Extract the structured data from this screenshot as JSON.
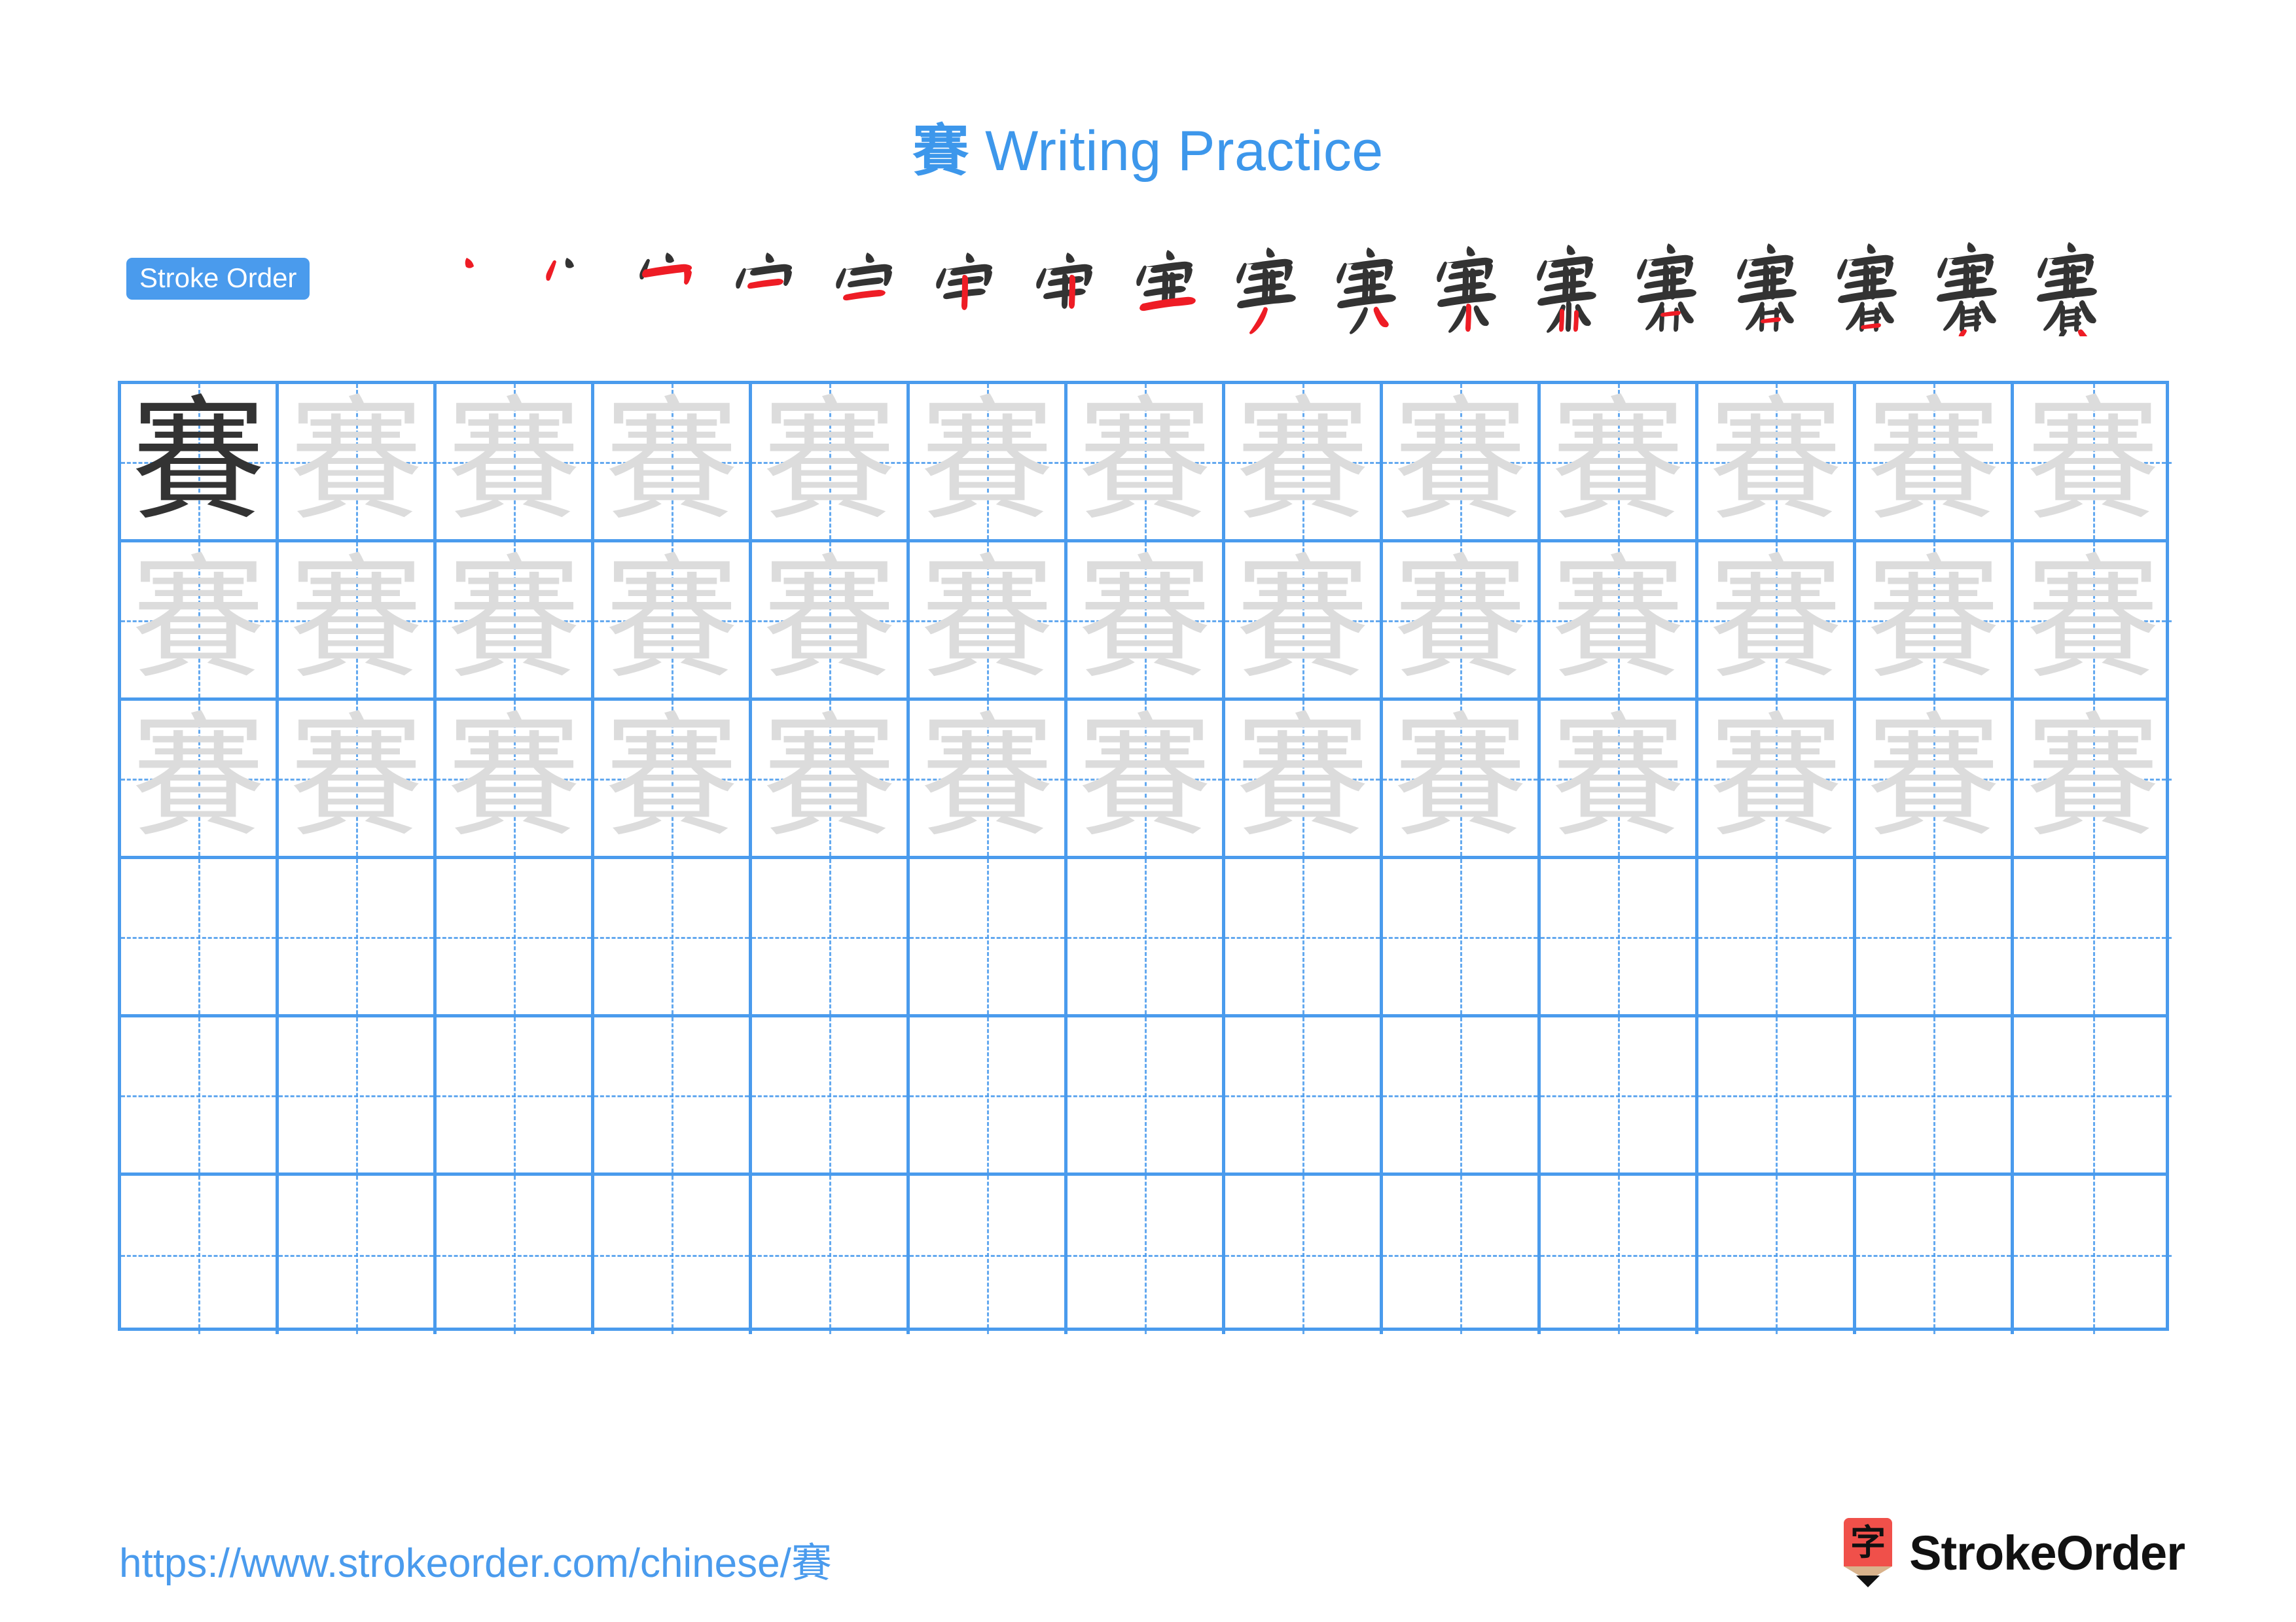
{
  "meta": {
    "character": "賽",
    "accent_blue": "#4a9bed",
    "title_blue": "#3d97eb",
    "trace_gray": "#dcdcdc",
    "ink_dark": "#333333",
    "stroke_highlight_red": "#ee1c25",
    "logo_red": "#f0504a"
  },
  "title": {
    "character": "賽",
    "text": " Writing Practice",
    "full": "賽 Writing Practice"
  },
  "stroke_order": {
    "badge_label": "Stroke Order",
    "total_strokes": 17,
    "steps": [
      {
        "index": 1,
        "partial": "丶"
      },
      {
        "index": 2,
        "partial": "丷"
      },
      {
        "index": 3,
        "partial": "宀"
      },
      {
        "index": 4,
        "partial": "宁"
      },
      {
        "index": 5,
        "partial": "宀+一"
      },
      {
        "index": 6,
        "partial": "宇"
      },
      {
        "index": 7,
        "partial": "军"
      },
      {
        "index": 8,
        "partial": "窜"
      },
      {
        "index": 9,
        "partial": "宲"
      },
      {
        "index": 10,
        "partial": "実"
      },
      {
        "index": 11,
        "partial": "寒"
      },
      {
        "index": 12,
        "partial": "寨"
      },
      {
        "index": 13,
        "partial": "賽-13"
      },
      {
        "index": 14,
        "partial": "賽-14"
      },
      {
        "index": 15,
        "partial": "賽-15"
      },
      {
        "index": 16,
        "partial": "賽-16"
      },
      {
        "index": 17,
        "partial": "賽"
      }
    ]
  },
  "practice_grid": {
    "columns": 13,
    "rows": 6,
    "rows_data": [
      {
        "row": 1,
        "cells": [
          {
            "char": "賽",
            "style": "dark"
          },
          {
            "char": "賽",
            "style": "trace"
          },
          {
            "char": "賽",
            "style": "trace"
          },
          {
            "char": "賽",
            "style": "trace"
          },
          {
            "char": "賽",
            "style": "trace"
          },
          {
            "char": "賽",
            "style": "trace"
          },
          {
            "char": "賽",
            "style": "trace"
          },
          {
            "char": "賽",
            "style": "trace"
          },
          {
            "char": "賽",
            "style": "trace"
          },
          {
            "char": "賽",
            "style": "trace"
          },
          {
            "char": "賽",
            "style": "trace"
          },
          {
            "char": "賽",
            "style": "trace"
          },
          {
            "char": "賽",
            "style": "trace"
          }
        ]
      },
      {
        "row": 2,
        "cells": [
          {
            "char": "賽",
            "style": "trace"
          },
          {
            "char": "賽",
            "style": "trace"
          },
          {
            "char": "賽",
            "style": "trace"
          },
          {
            "char": "賽",
            "style": "trace"
          },
          {
            "char": "賽",
            "style": "trace"
          },
          {
            "char": "賽",
            "style": "trace"
          },
          {
            "char": "賽",
            "style": "trace"
          },
          {
            "char": "賽",
            "style": "trace"
          },
          {
            "char": "賽",
            "style": "trace"
          },
          {
            "char": "賽",
            "style": "trace"
          },
          {
            "char": "賽",
            "style": "trace"
          },
          {
            "char": "賽",
            "style": "trace"
          },
          {
            "char": "賽",
            "style": "trace"
          }
        ]
      },
      {
        "row": 3,
        "cells": [
          {
            "char": "賽",
            "style": "trace"
          },
          {
            "char": "賽",
            "style": "trace"
          },
          {
            "char": "賽",
            "style": "trace"
          },
          {
            "char": "賽",
            "style": "trace"
          },
          {
            "char": "賽",
            "style": "trace"
          },
          {
            "char": "賽",
            "style": "trace"
          },
          {
            "char": "賽",
            "style": "trace"
          },
          {
            "char": "賽",
            "style": "trace"
          },
          {
            "char": "賽",
            "style": "trace"
          },
          {
            "char": "賽",
            "style": "trace"
          },
          {
            "char": "賽",
            "style": "trace"
          },
          {
            "char": "賽",
            "style": "trace"
          },
          {
            "char": "賽",
            "style": "trace"
          }
        ]
      },
      {
        "row": 4,
        "cells": [
          {
            "char": "",
            "style": "blank"
          },
          {
            "char": "",
            "style": "blank"
          },
          {
            "char": "",
            "style": "blank"
          },
          {
            "char": "",
            "style": "blank"
          },
          {
            "char": "",
            "style": "blank"
          },
          {
            "char": "",
            "style": "blank"
          },
          {
            "char": "",
            "style": "blank"
          },
          {
            "char": "",
            "style": "blank"
          },
          {
            "char": "",
            "style": "blank"
          },
          {
            "char": "",
            "style": "blank"
          },
          {
            "char": "",
            "style": "blank"
          },
          {
            "char": "",
            "style": "blank"
          },
          {
            "char": "",
            "style": "blank"
          }
        ]
      },
      {
        "row": 5,
        "cells": [
          {
            "char": "",
            "style": "blank"
          },
          {
            "char": "",
            "style": "blank"
          },
          {
            "char": "",
            "style": "blank"
          },
          {
            "char": "",
            "style": "blank"
          },
          {
            "char": "",
            "style": "blank"
          },
          {
            "char": "",
            "style": "blank"
          },
          {
            "char": "",
            "style": "blank"
          },
          {
            "char": "",
            "style": "blank"
          },
          {
            "char": "",
            "style": "blank"
          },
          {
            "char": "",
            "style": "blank"
          },
          {
            "char": "",
            "style": "blank"
          },
          {
            "char": "",
            "style": "blank"
          },
          {
            "char": "",
            "style": "blank"
          }
        ]
      },
      {
        "row": 6,
        "cells": [
          {
            "char": "",
            "style": "blank"
          },
          {
            "char": "",
            "style": "blank"
          },
          {
            "char": "",
            "style": "blank"
          },
          {
            "char": "",
            "style": "blank"
          },
          {
            "char": "",
            "style": "blank"
          },
          {
            "char": "",
            "style": "blank"
          },
          {
            "char": "",
            "style": "blank"
          },
          {
            "char": "",
            "style": "blank"
          },
          {
            "char": "",
            "style": "blank"
          },
          {
            "char": "",
            "style": "blank"
          },
          {
            "char": "",
            "style": "blank"
          },
          {
            "char": "",
            "style": "blank"
          },
          {
            "char": "",
            "style": "blank"
          }
        ]
      }
    ]
  },
  "footer": {
    "url_prefix": "https://www.strokeorder.com/chinese/",
    "url_character": "賽",
    "url_full": "https://www.strokeorder.com/chinese/賽",
    "brand_name": "StrokeOrder",
    "brand_mark_character": "字"
  }
}
